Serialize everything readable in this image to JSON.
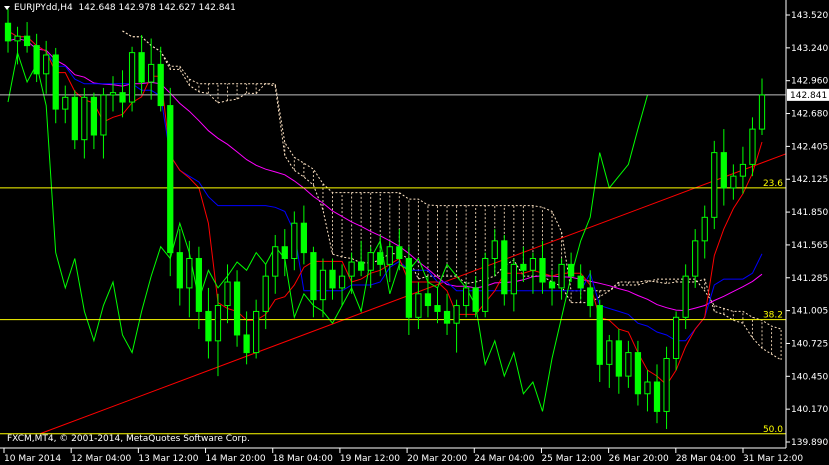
{
  "header": {
    "symbol": "EURJPYdd,H4",
    "ohlc": "142.648 142.978 142.627 142.841"
  },
  "copyright": "FXCM,MT4, © 2001-2014, MetaQuotes Software Corp.",
  "colors": {
    "background": "#000000",
    "axis": "#ffffff",
    "bull_candle": "#00ff00",
    "bear_candle": "#00ff00",
    "fibo": "#ffff00",
    "trendline": "#ff0000",
    "tenkan": "#ff0000",
    "kijun": "#0000ff",
    "chikou": "#00ff00",
    "senkou_span": "#ffe4c4",
    "ma": "#ff00ff",
    "bid_line": "#c0c0c0"
  },
  "chart_data": {
    "type": "candlestick",
    "symbol": "EURJPYdd",
    "timeframe": "H4",
    "ylim": [
      139.89,
      143.62
    ],
    "y_ticks": [
      "143.520",
      "143.240",
      "142.960",
      "142.680",
      "142.405",
      "142.125",
      "141.850",
      "141.565",
      "141.285",
      "141.005",
      "140.725",
      "140.450",
      "140.170",
      "139.890"
    ],
    "x_ticks": [
      "10 Mar 2014",
      "12 Mar 04:00",
      "13 Mar 12:00",
      "14 Mar 20:00",
      "18 Mar 04:00",
      "19 Mar 12:00",
      "20 Mar 20:00",
      "24 Mar 04:00",
      "25 Mar 12:00",
      "26 Mar 20:00",
      "28 Mar 04:00",
      "31 Mar 12:00"
    ],
    "current_price": "142.841",
    "fibo_levels": [
      {
        "label": "23.6",
        "price": 142.05
      },
      {
        "label": "38.2",
        "price": 140.93
      },
      {
        "label": "50.0",
        "price": 139.96
      }
    ],
    "candles": [
      [
        143.45,
        143.57,
        143.2,
        143.3
      ],
      [
        143.3,
        143.42,
        143.1,
        143.34
      ],
      [
        143.34,
        143.46,
        143.2,
        143.26
      ],
      [
        143.26,
        143.36,
        142.95,
        143.02
      ],
      [
        143.02,
        143.3,
        142.85,
        143.18
      ],
      [
        143.18,
        143.24,
        142.6,
        142.72
      ],
      [
        142.72,
        142.92,
        142.6,
        142.82
      ],
      [
        142.82,
        142.88,
        142.38,
        142.46
      ],
      [
        142.46,
        142.9,
        142.3,
        142.82
      ],
      [
        142.82,
        142.86,
        142.38,
        142.5
      ],
      [
        142.5,
        142.9,
        142.3,
        142.84
      ],
      [
        142.84,
        143.0,
        142.7,
        142.86
      ],
      [
        142.86,
        143.05,
        142.65,
        142.78
      ],
      [
        142.78,
        143.25,
        142.7,
        143.2
      ],
      [
        143.2,
        143.35,
        142.85,
        142.95
      ],
      [
        142.95,
        143.32,
        142.8,
        143.1
      ],
      [
        143.1,
        143.25,
        142.7,
        142.75
      ],
      [
        142.75,
        142.9,
        141.3,
        141.5
      ],
      [
        141.5,
        141.7,
        141.05,
        141.2
      ],
      [
        141.2,
        141.6,
        140.95,
        141.45
      ],
      [
        141.45,
        141.55,
        140.85,
        141.0
      ],
      [
        141.0,
        141.2,
        140.6,
        140.75
      ],
      [
        140.75,
        141.15,
        140.45,
        141.05
      ],
      [
        141.05,
        141.4,
        140.9,
        141.25
      ],
      [
        141.25,
        141.35,
        140.7,
        140.8
      ],
      [
        140.8,
        141.0,
        140.55,
        140.65
      ],
      [
        140.65,
        141.1,
        140.6,
        141.0
      ],
      [
        141.0,
        141.4,
        140.85,
        141.3
      ],
      [
        141.3,
        141.65,
        141.15,
        141.55
      ],
      [
        141.55,
        141.7,
        141.3,
        141.45
      ],
      [
        141.45,
        141.85,
        141.35,
        141.75
      ],
      [
        141.75,
        141.9,
        141.4,
        141.5
      ],
      [
        141.5,
        141.55,
        140.95,
        141.1
      ],
      [
        141.1,
        141.45,
        140.95,
        141.35
      ],
      [
        141.35,
        141.45,
        141.1,
        141.2
      ],
      [
        141.2,
        141.4,
        141.05,
        141.3
      ],
      [
        141.3,
        141.5,
        141.15,
        141.42
      ],
      [
        141.42,
        141.6,
        141.3,
        141.35
      ],
      [
        141.35,
        141.55,
        141.2,
        141.5
      ],
      [
        141.5,
        141.65,
        141.3,
        141.4
      ],
      [
        141.4,
        141.6,
        141.25,
        141.55
      ],
      [
        141.55,
        141.7,
        141.35,
        141.45
      ],
      [
        141.45,
        141.55,
        140.8,
        140.95
      ],
      [
        140.95,
        141.25,
        140.85,
        141.15
      ],
      [
        141.15,
        141.3,
        140.95,
        141.05
      ],
      [
        141.05,
        141.2,
        140.9,
        141.0
      ],
      [
        141.0,
        141.15,
        140.8,
        140.9
      ],
      [
        140.9,
        141.1,
        140.65,
        141.05
      ],
      [
        141.05,
        141.25,
        140.95,
        141.2
      ],
      [
        141.2,
        141.3,
        140.95,
        141.0
      ],
      [
        141.0,
        141.5,
        140.95,
        141.45
      ],
      [
        141.45,
        141.7,
        141.3,
        141.6
      ],
      [
        141.6,
        141.65,
        141.05,
        141.15
      ],
      [
        141.15,
        141.45,
        141.0,
        141.4
      ],
      [
        141.4,
        141.55,
        141.25,
        141.35
      ],
      [
        141.35,
        141.5,
        141.15,
        141.45
      ],
      [
        141.45,
        141.6,
        141.15,
        141.25
      ],
      [
        141.25,
        141.35,
        141.05,
        141.2
      ],
      [
        141.2,
        141.45,
        141.1,
        141.4
      ],
      [
        141.4,
        141.5,
        141.25,
        141.3
      ],
      [
        141.3,
        141.4,
        141.1,
        141.2
      ],
      [
        141.2,
        141.35,
        140.95,
        141.05
      ],
      [
        141.05,
        141.1,
        140.4,
        140.55
      ],
      [
        140.55,
        140.8,
        140.35,
        140.75
      ],
      [
        140.75,
        140.85,
        140.3,
        140.45
      ],
      [
        140.45,
        140.75,
        140.35,
        140.65
      ],
      [
        140.65,
        140.75,
        140.2,
        140.3
      ],
      [
        140.3,
        140.5,
        140.15,
        140.4
      ],
      [
        140.4,
        140.55,
        140.05,
        140.15
      ],
      [
        140.15,
        140.7,
        140.0,
        140.6
      ],
      [
        140.6,
        141.0,
        140.5,
        140.95
      ],
      [
        140.95,
        141.4,
        140.85,
        141.3
      ],
      [
        141.3,
        141.7,
        141.2,
        141.6
      ],
      [
        141.6,
        141.9,
        141.45,
        141.8
      ],
      [
        141.8,
        142.45,
        141.7,
        142.35
      ],
      [
        142.35,
        142.55,
        141.9,
        142.05
      ],
      [
        142.05,
        142.25,
        141.95,
        142.15
      ],
      [
        142.15,
        142.4,
        142.0,
        142.25
      ],
      [
        142.25,
        142.65,
        142.15,
        142.55
      ],
      [
        142.55,
        142.98,
        142.5,
        142.84
      ]
    ]
  }
}
